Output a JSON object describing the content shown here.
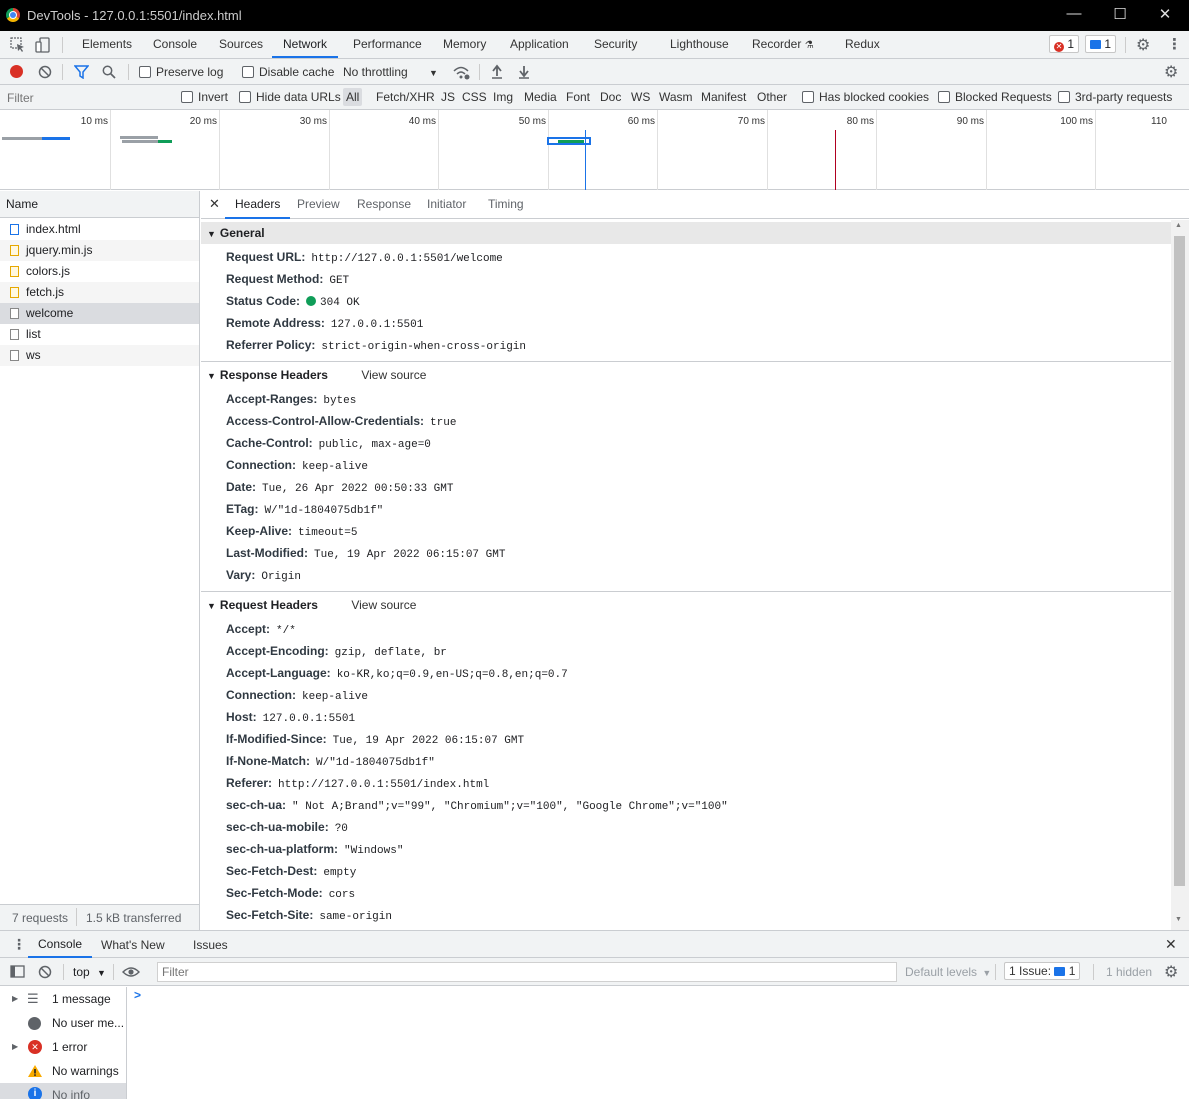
{
  "window": {
    "title": "DevTools - 127.0.0.1:5501/index.html",
    "controls": [
      "—",
      "☐",
      "✕"
    ]
  },
  "tabs": [
    "Elements",
    "Console",
    "Sources",
    "Network",
    "Performance",
    "Memory",
    "Application",
    "Security",
    "Lighthouse",
    "Recorder",
    "Redux"
  ],
  "active_tab": "Network",
  "counters": {
    "errors": "1",
    "messages": "1"
  },
  "toolbar": {
    "preserve_log": "Preserve log",
    "disable_cache": "Disable cache",
    "throttling": "No throttling"
  },
  "filter": {
    "placeholder": "Filter",
    "invert": "Invert",
    "hide_data_urls": "Hide data URLs",
    "types": [
      "All",
      "Fetch/XHR",
      "JS",
      "CSS",
      "Img",
      "Media",
      "Font",
      "Doc",
      "WS",
      "Wasm",
      "Manifest",
      "Other"
    ],
    "has_blocked_cookies": "Has blocked cookies",
    "blocked_requests": "Blocked Requests",
    "third_party": "3rd-party requests"
  },
  "timeline": {
    "ticks": [
      "10 ms",
      "20 ms",
      "30 ms",
      "40 ms",
      "50 ms",
      "60 ms",
      "70 ms",
      "80 ms",
      "90 ms",
      "100 ms",
      "110"
    ]
  },
  "name_column": {
    "header": "Name",
    "rows": [
      {
        "name": "index.html",
        "type": "doc"
      },
      {
        "name": "jquery.min.js",
        "type": "js"
      },
      {
        "name": "colors.js",
        "type": "js"
      },
      {
        "name": "fetch.js",
        "type": "js"
      },
      {
        "name": "welcome",
        "type": "other"
      },
      {
        "name": "list",
        "type": "other"
      },
      {
        "name": "ws",
        "type": "other"
      }
    ],
    "summary_requests": "7 requests",
    "summary_transferred": "1.5 kB transferred"
  },
  "detail_tabs": [
    "Headers",
    "Preview",
    "Response",
    "Initiator",
    "Timing"
  ],
  "general": {
    "title": "General",
    "items": [
      {
        "k": "Request URL:",
        "v": "http://127.0.0.1:5501/welcome"
      },
      {
        "k": "Request Method:",
        "v": "GET"
      },
      {
        "k": "Status Code:",
        "v": "304 OK"
      },
      {
        "k": "Remote Address:",
        "v": "127.0.0.1:5501"
      },
      {
        "k": "Referrer Policy:",
        "v": "strict-origin-when-cross-origin"
      }
    ]
  },
  "response_headers": {
    "title": "Response Headers",
    "view_source": "View source",
    "items": [
      {
        "k": "Accept-Ranges:",
        "v": "bytes"
      },
      {
        "k": "Access-Control-Allow-Credentials:",
        "v": "true"
      },
      {
        "k": "Cache-Control:",
        "v": "public, max-age=0"
      },
      {
        "k": "Connection:",
        "v": "keep-alive"
      },
      {
        "k": "Date:",
        "v": "Tue, 26 Apr 2022 00:50:33 GMT"
      },
      {
        "k": "ETag:",
        "v": "W/\"1d-1804075db1f\""
      },
      {
        "k": "Keep-Alive:",
        "v": "timeout=5"
      },
      {
        "k": "Last-Modified:",
        "v": "Tue, 19 Apr 2022 06:15:07 GMT"
      },
      {
        "k": "Vary:",
        "v": "Origin"
      }
    ]
  },
  "request_headers": {
    "title": "Request Headers",
    "view_source": "View source",
    "items": [
      {
        "k": "Accept:",
        "v": "*/*"
      },
      {
        "k": "Accept-Encoding:",
        "v": "gzip, deflate, br"
      },
      {
        "k": "Accept-Language:",
        "v": "ko-KR,ko;q=0.9,en-US;q=0.8,en;q=0.7"
      },
      {
        "k": "Connection:",
        "v": "keep-alive"
      },
      {
        "k": "Host:",
        "v": "127.0.0.1:5501"
      },
      {
        "k": "If-Modified-Since:",
        "v": "Tue, 19 Apr 2022 06:15:07 GMT"
      },
      {
        "k": "If-None-Match:",
        "v": "W/\"1d-1804075db1f\""
      },
      {
        "k": "Referer:",
        "v": "http://127.0.0.1:5501/index.html"
      },
      {
        "k": "sec-ch-ua:",
        "v": "\" Not A;Brand\";v=\"99\", \"Chromium\";v=\"100\", \"Google Chrome\";v=\"100\""
      },
      {
        "k": "sec-ch-ua-mobile:",
        "v": "?0"
      },
      {
        "k": "sec-ch-ua-platform:",
        "v": "\"Windows\""
      },
      {
        "k": "Sec-Fetch-Dest:",
        "v": "empty"
      },
      {
        "k": "Sec-Fetch-Mode:",
        "v": "cors"
      },
      {
        "k": "Sec-Fetch-Site:",
        "v": "same-origin"
      }
    ]
  },
  "drawer": {
    "tabs": [
      "Console",
      "What's New",
      "Issues"
    ],
    "context": "top",
    "filter_placeholder": "Filter",
    "levels": "Default levels",
    "issues": "1 Issue:",
    "issues_count": "1",
    "hidden": "1 hidden",
    "prompt": ">",
    "sidebar": [
      {
        "label": "1 message",
        "icon": "list-icon"
      },
      {
        "label": "No user me...",
        "icon": "user-icon"
      },
      {
        "label": "1 error",
        "icon": "error-icon"
      },
      {
        "label": "No warnings",
        "icon": "warning-icon"
      },
      {
        "label": "No info",
        "icon": "info-icon"
      }
    ]
  },
  "colors": {
    "accent": "#1a73e8",
    "error": "#d93025",
    "status_ok": "#0f9d58"
  }
}
